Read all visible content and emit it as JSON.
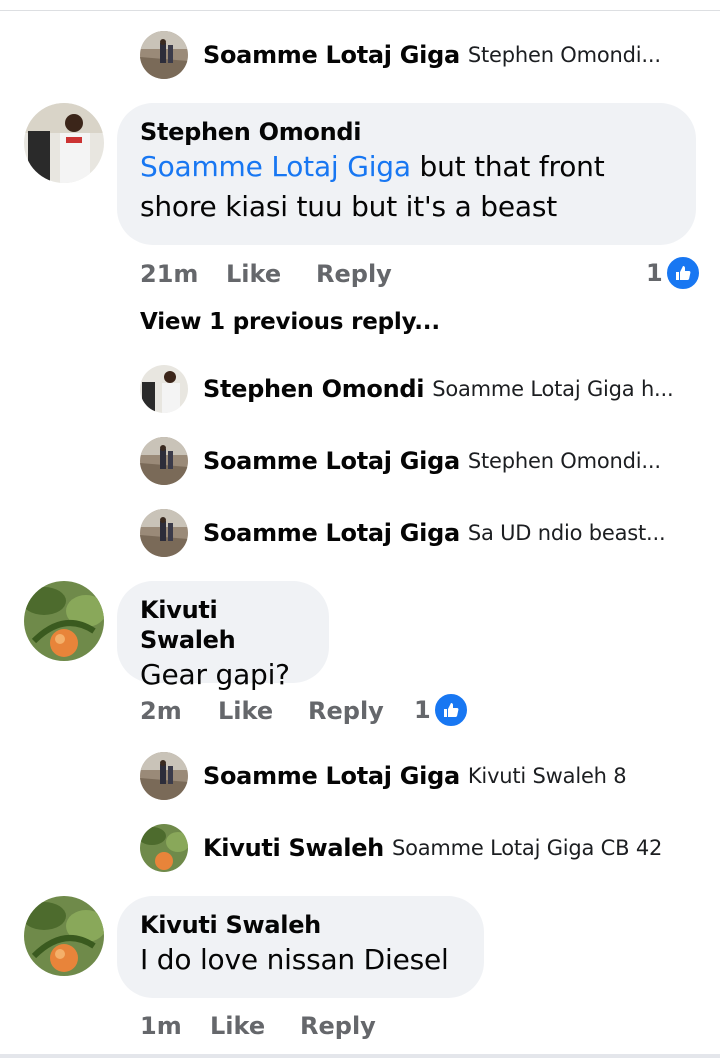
{
  "comments": [
    {
      "replies_top": [
        {
          "name": "Soamme Lotaj Giga",
          "text": "Stephen Omondi..."
        }
      ]
    },
    {
      "author": "Stephen Omondi",
      "mention": "Soamme Lotaj Giga",
      "text_line1": " but that front",
      "text_line2": "shore kiasi tuu but it's a beast",
      "time": "21m",
      "like_label": "Like",
      "reply_label": "Reply",
      "like_count": "1",
      "view_previous": "View 1 previous reply...",
      "replies": [
        {
          "name": "Stephen Omondi",
          "text": "Soamme Lotaj Giga h..."
        },
        {
          "name": "Soamme Lotaj Giga",
          "text": "Stephen Omondi..."
        },
        {
          "name": "Soamme Lotaj Giga",
          "text": "Sa UD ndio beast..."
        }
      ]
    },
    {
      "author": "Kivuti Swaleh",
      "text": "Gear gapi?",
      "time": "2m",
      "like_label": "Like",
      "reply_label": "Reply",
      "like_count": "1",
      "replies": [
        {
          "name": "Soamme Lotaj Giga",
          "text": "Kivuti Swaleh 8"
        },
        {
          "name": "Kivuti Swaleh",
          "text": "Soamme Lotaj Giga CB 42"
        }
      ]
    },
    {
      "author": "Kivuti Swaleh",
      "text": "I do love nissan Diesel",
      "time": "1m",
      "like_label": "Like",
      "reply_label": "Reply"
    }
  ],
  "colors": {
    "mention": "#1877f2",
    "bubble": "#f0f2f5",
    "meta": "#65676b",
    "like_badge": "#1877f2"
  },
  "icons": {
    "like_badge": "thumbs-up-icon",
    "avatar_soamme": "road-photo-avatar",
    "avatar_stephen": "person-photo-avatar",
    "avatar_kivuti": "fruit-photo-avatar"
  }
}
